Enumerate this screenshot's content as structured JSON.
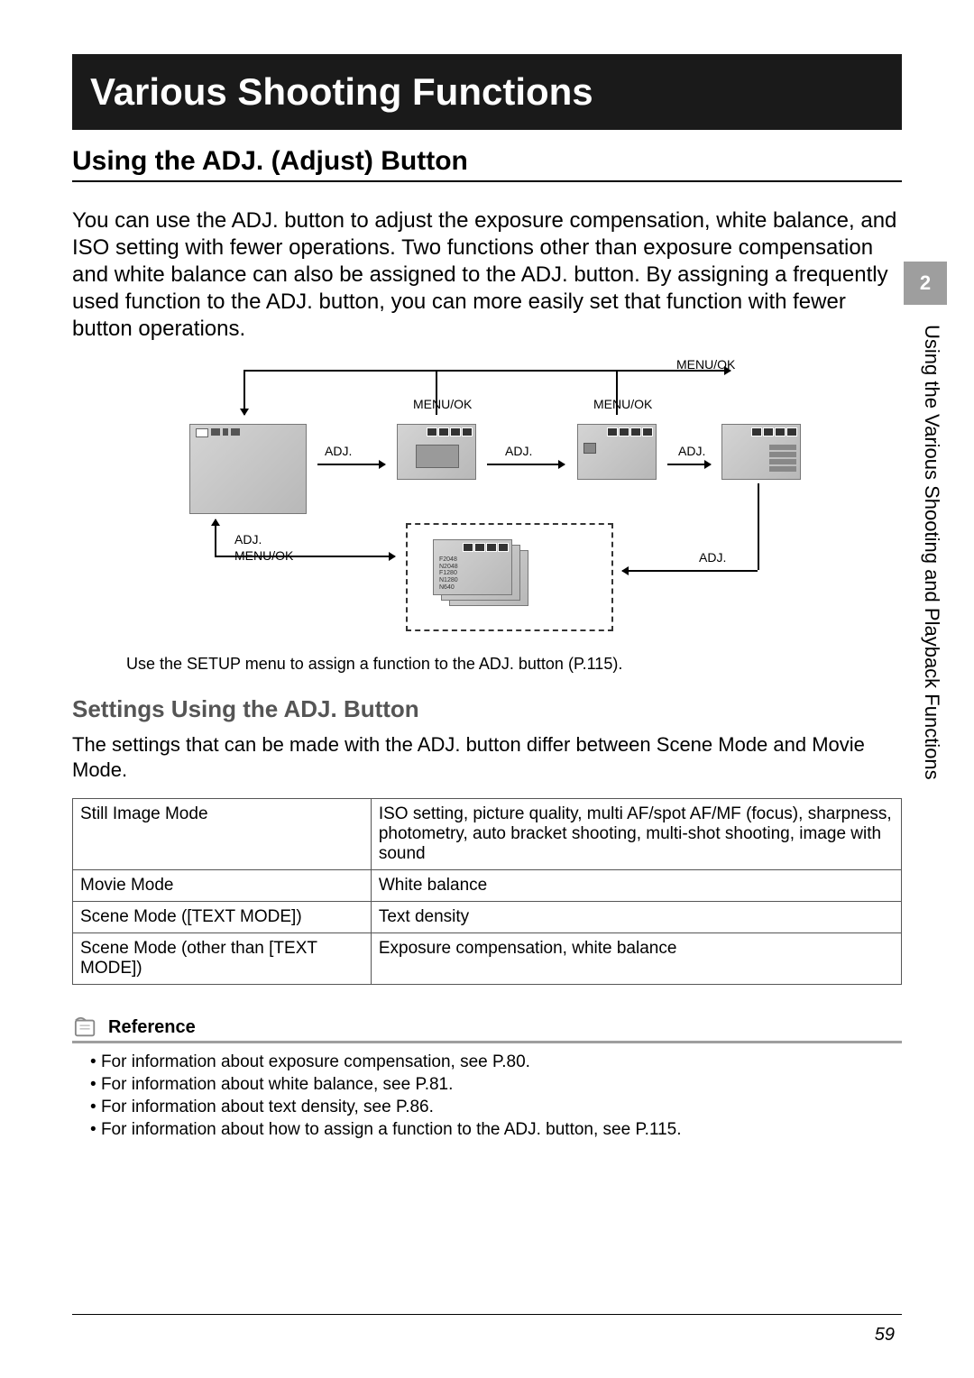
{
  "chapter_title": "Various Shooting Functions",
  "section_heading": "Using the ADJ. (Adjust) Button",
  "intro_paragraph": "You can use the ADJ. button to adjust the exposure compensation, white balance, and ISO setting with fewer operations. Two functions other than exposure compensation and white balance can also be assigned to the ADJ. button. By assigning a frequently used function to the ADJ. button, you can more easily set that function with fewer button operations.",
  "side_tab_number": "2",
  "side_label": "Using the Various Shooting and Playback Functions",
  "diagram": {
    "labels": {
      "menu_ok": "MENU/OK",
      "adj": "ADJ."
    },
    "caption": "Use the SETUP menu to assign a function to the ADJ. button (P.115)."
  },
  "subsection_heading": "Settings Using the ADJ. Button",
  "subsection_body": "The settings that can be made with the ADJ. button differ between Scene Mode and Movie Mode.",
  "settings_table": [
    {
      "mode": "Still Image Mode",
      "desc": "ISO setting, picture quality, multi AF/spot AF/MF (focus), sharpness, photometry, auto bracket shooting, multi-shot shooting, image with sound"
    },
    {
      "mode": "Movie Mode",
      "desc": "White balance"
    },
    {
      "mode": "Scene Mode ([TEXT MODE])",
      "desc": "Text density"
    },
    {
      "mode": "Scene Mode (other than [TEXT MODE])",
      "desc": "Exposure compensation, white balance"
    }
  ],
  "reference_label": "Reference",
  "reference_items": [
    "For information about exposure compensation, see P.80.",
    "For information about white balance, see P.81.",
    "For information about text density, see P.86.",
    "For information about how to assign a function to the ADJ. button, see P.115."
  ],
  "page_number": "59"
}
